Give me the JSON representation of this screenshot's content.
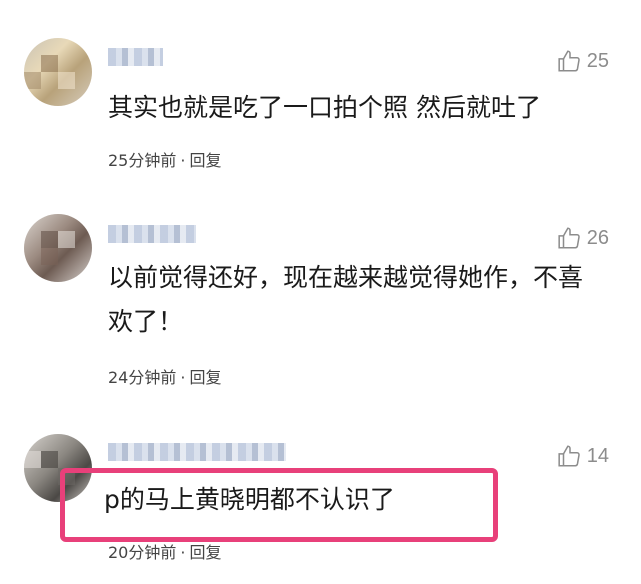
{
  "comments": [
    {
      "text": "其实也就是吃了一口拍个照 然后就吐了",
      "likes": "25",
      "time": "25分钟前",
      "separator": "·",
      "reply": "回复"
    },
    {
      "text": "以前觉得还好，现在越来越觉得她作，不喜欢了！",
      "likes": "26",
      "time": "24分钟前",
      "separator": "·",
      "reply": "回复"
    },
    {
      "text": "p的马上黄晓明都不认识了",
      "likes": "14",
      "time": "20分钟前",
      "separator": "·",
      "reply": "回复"
    }
  ],
  "highlight_color": "#e8407a",
  "icon": "thumbs-up-icon"
}
